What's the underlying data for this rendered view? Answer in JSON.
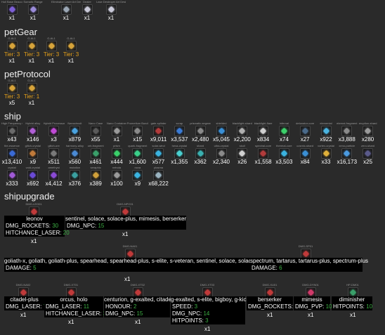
{
  "top": {
    "items": [
      {
        "label": "Hull Base Beacon",
        "qty": "x1",
        "color": "#7d5fd6"
      },
      {
        "label": "Somatic Range",
        "qty": "x1",
        "color": "#9a8bd8"
      },
      {
        "label": "Eliminator Laser Art Design",
        "qty": "x1",
        "color": "#9ba7b5"
      },
      {
        "label": "Dealer",
        "qty": "x1",
        "color": "#c9c9d8"
      },
      {
        "label": "Lase Destroyer Art Design",
        "qty": "x1",
        "color": "#c9c9d8"
      }
    ]
  },
  "petGear": {
    "title": "petGear",
    "items": [
      {
        "label": "G-AL1",
        "tier": "Tier: 3",
        "qty": "x1",
        "color": "#d6a33a"
      },
      {
        "label": "G-AL1",
        "tier": "Tier: 3",
        "qty": "x1",
        "color": "#d6a33a"
      },
      {
        "label": "G-AL1",
        "tier": "Tier: 3",
        "qty": "x1",
        "color": "#d6a33a"
      },
      {
        "label": "G-AL1",
        "tier": "Tier: 3",
        "qty": "x1",
        "color": "#d6a33a"
      }
    ]
  },
  "petProtocol": {
    "title": "petProtocol",
    "items": [
      {
        "label": "G-AL1",
        "tier": "Tier: 3",
        "qty": "x5",
        "color": "#d6a33a"
      },
      {
        "label": "G-AL1",
        "tier": "Tier: 1",
        "qty": "x1",
        "color": "#d6a33a"
      }
    ]
  },
  "ship": {
    "title": "ship",
    "rows": [
      [
        {
          "label": "High Frequency Cable",
          "qty": "x43",
          "color": "#6a6a6a"
        },
        {
          "label": "Hybrid alloy",
          "qty": "x146",
          "color": "#b05fd6"
        },
        {
          "label": "Hybrid Processor",
          "qty": "x3",
          "color": "#c04ad6"
        },
        {
          "label": "Nanocircuit",
          "qty": "x879",
          "color": "#4aa3e0"
        },
        {
          "label": "Nano Case",
          "qty": "x55",
          "color": "#5a5a5a"
        },
        {
          "label": "Nano Container",
          "qty": "x1",
          "color": "#9a9a9a"
        },
        {
          "label": "Prometium Bundle",
          "qty": "x15",
          "color": "#8a8a8a"
        },
        {
          "label": "gate-splinter",
          "qty": "x9,011",
          "color": "#b23b3b"
        },
        {
          "label": "scrap",
          "qty": "x3,537",
          "color": "#3a7bd5"
        },
        {
          "label": "prismatic-segment",
          "qty": "x2,480",
          "color": "#8a8a8a"
        },
        {
          "label": "shielded",
          "qty": "x5,045",
          "color": "#3a8fd5"
        },
        {
          "label": "blacklight-shard",
          "qty": "x2,200",
          "color": "#b0b0b0"
        },
        {
          "label": "blacklight-flare",
          "qty": "x834",
          "color": "#d0d0d0"
        },
        {
          "label": "infernal",
          "qty": "x74",
          "color": "#3cd06a"
        },
        {
          "label": "detonator-core",
          "qty": "x27",
          "color": "#4a6a8a"
        },
        {
          "label": "elemental",
          "qty": "x922",
          "color": "#4ab3e0"
        },
        {
          "label": "eternal-fragment",
          "qty": "x3,888",
          "color": "#8a8a8a"
        },
        {
          "label": "eruption-shard",
          "qty": "x280",
          "color": "#9a9a9a"
        }
      ],
      [
        {
          "label": "fire-essence",
          "qty": "x13,410",
          "color": "#3a6ad5"
        },
        {
          "label": "glitch-crystal",
          "qty": "x9",
          "color": "#c07a3a"
        },
        {
          "label": "glitch-ore",
          "qty": "x511",
          "color": "#7a7a7a"
        },
        {
          "label": "harmony-alloy",
          "qty": "x560",
          "color": "#4a8ad5"
        },
        {
          "label": "orb-fragment",
          "qty": "x461",
          "color": "#3aa06a"
        },
        {
          "label": "prism",
          "qty": "x444",
          "color": "#3ad06a"
        },
        {
          "label": "quark-fragment",
          "qty": "x1,600",
          "color": "#3ad08a"
        },
        {
          "label": "solar-wind",
          "qty": "x577",
          "color": "#3ab3e0"
        },
        {
          "label": "hexa-crystal",
          "qty": "x1,355",
          "color": "#4ad0d0"
        },
        {
          "label": "shard",
          "qty": "x362",
          "color": "#3ab0b0"
        },
        {
          "label": "ultra-crystal",
          "qty": "x2,340",
          "color": "#8a8a8a"
        },
        {
          "label": "skull",
          "qty": "x26",
          "color": "#d0d0d0"
        },
        {
          "label": "spectral-core",
          "qty": "x1,558",
          "color": "#b23b3b"
        },
        {
          "label": "thermal-core",
          "qty": "x3,503",
          "color": "#3ab3e0"
        },
        {
          "label": "cosmic-shard",
          "qty": "x84",
          "color": "#3a8fd5"
        },
        {
          "label": "vortex-crystal",
          "qty": "x33",
          "color": "#e0b03a"
        },
        {
          "label": "xeno-particle",
          "qty": "x16,173",
          "color": "#4a9ae0"
        },
        {
          "label": "zero-shard",
          "qty": "x25",
          "color": "#5a5a8a"
        }
      ],
      [
        {
          "label": "crystal",
          "qty": "x333",
          "color": "#a05ad6"
        },
        {
          "label": "void-crystal",
          "qty": "x692",
          "color": "#6a4ad6"
        },
        {
          "label": "amethyst",
          "qty": "x4,412",
          "color": "#8a4ad6"
        },
        {
          "label": "mutation",
          "qty": "x376",
          "color": "#3aa0a0"
        },
        {
          "label": "seraphic",
          "qty": "x389",
          "color": "#d0a03a"
        },
        {
          "label": "nebula",
          "qty": "x100",
          "color": "#9a9a9a"
        },
        {
          "label": "nova",
          "qty": "x9",
          "color": "#3ab3e0"
        },
        {
          "label": "plasma",
          "qty": "x68,222",
          "color": "#9ab3c0"
        }
      ]
    ]
  },
  "shipupgrade": {
    "title": "shipupgrade",
    "tier1": {
      "nodes": [
        {
          "label": "DMG-LEO01",
          "title": "leonov",
          "qty": "x1",
          "color": "#c03a3a",
          "stats": [
            {
              "k": "DMG_ROCKETS: ",
              "v": "30"
            },
            {
              "k": "HITCHANCE_LASER: ",
              "v": "20"
            }
          ]
        },
        {
          "label": "DMG-NPC01",
          "title": "sentinel, solace, solace-plus, mimesis, berserker",
          "qty": "x1",
          "color": "#c03a3a",
          "stats": [
            {
              "k": "DMG_NPC: ",
              "v": "15"
            }
          ]
        }
      ]
    },
    "tier2": {
      "nodes": [
        {
          "label": "DMG-NA01",
          "title": "goliath-x, goliath, goliath-plus, spearhead, spearhead-plus, s-elite, s-veteran, sentinel, solace, solace-plus",
          "color": "#c03a3a",
          "stats": [
            {
              "k": "DAMAGE: ",
              "v": "5"
            }
          ]
        },
        {
          "label": "DMG-SP01",
          "title": "spectrum, tartarus, tartarus-plus, spectrum-plus",
          "color": "#c03a3a",
          "stats": [
            {
              "k": "DAMAGE: ",
              "v": "6"
            }
          ]
        }
      ],
      "qty": "x1"
    },
    "tier3": {
      "nodes": [
        {
          "label": "DMG-NA02",
          "title": "citadel-plus",
          "qty": "x1",
          "color": "#c03a3a",
          "stats": [
            {
              "k": "DMG_LASER: ",
              "v": "7"
            }
          ]
        },
        {
          "label": "DMG-XT01",
          "title": "orcus, holo",
          "qty": "x1",
          "color": "#c03a3a",
          "stats": [
            {
              "k": "DMG_LASER: ",
              "v": "11"
            },
            {
              "k": "HITCHANCE_LASER: ",
              "v": "3"
            }
          ]
        },
        {
          "label": "DMG-XT02",
          "title": "centurion, g-exalted, citadel",
          "qty": "x1",
          "color": "#c03a3a",
          "stats": [
            {
              "k": "HONOUR: ",
              "v": "2"
            },
            {
              "k": "DMG_NPC: ",
              "v": "15"
            }
          ]
        },
        {
          "label": "DMG-XT03",
          "title": "g-exalted, s-elite, bigboy, g-kick",
          "qty": "x1",
          "color": "#c03a3a",
          "stats": [
            {
              "k": "SPEED: ",
              "v": "3"
            },
            {
              "k": "DMG_NPC: ",
              "v": "14"
            },
            {
              "k": "HITPOINTS: ",
              "v": "3"
            }
          ]
        },
        {
          "label": "DMG-XU01",
          "title": "berserker",
          "qty": "x1",
          "color": "#c03a3a",
          "stats": [
            {
              "k": "DMG_ROCKETS: ",
              "v": "7"
            }
          ]
        },
        {
          "label": "DMG-DYN01",
          "title": "mimesis",
          "qty": "x1",
          "color": "#d03a6a",
          "stats": [
            {
              "k": "DMG_PVP: ",
              "v": "10"
            }
          ]
        },
        {
          "label": "HP-DM01",
          "title": "diminisher",
          "qty": "x1",
          "color": "#3aa06a",
          "stats": [
            {
              "k": "HITPOINTS: ",
              "v": "10"
            }
          ]
        }
      ]
    }
  }
}
